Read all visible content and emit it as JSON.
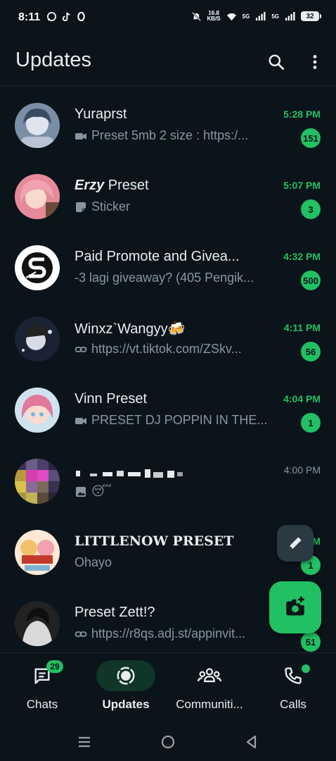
{
  "status_bar": {
    "time": "8:11",
    "speed_value": "16.8",
    "speed_unit": "KB/S",
    "net1": "5G",
    "net2": "5G",
    "battery": "32",
    "left_icons": [
      "whatsapp-icon",
      "tiktok-icon",
      "circle-o-icon"
    ],
    "right_icons": [
      "mute-icon",
      "wifi-icon",
      "signal-icon",
      "signal-icon",
      "battery-icon"
    ]
  },
  "header": {
    "title": "Updates",
    "icons": [
      "search-icon",
      "more-vert-icon"
    ]
  },
  "chats": [
    {
      "name": "Yuraprst",
      "time": "5:28 PM",
      "preview": "Preset 5mb 2 size : https:/...",
      "preview_icon": "video-icon",
      "unread": "151",
      "avatar_color": "#7a8ea6"
    },
    {
      "name_emph": "Erzy",
      "name": " Preset",
      "time": "5:07 PM",
      "preview": "Sticker",
      "preview_icon": "sticker-icon",
      "unread": "3",
      "avatar_color": "#e58a9b"
    },
    {
      "name": "Paid Promote and Givea...",
      "time": "4:32 PM",
      "preview": "-3 lagi giveaway? (405 Pengik...",
      "preview_icon": "",
      "unread": "500",
      "avatar_color": "#ffffff"
    },
    {
      "name": "Winxz`Wangyy🍻",
      "time": "4:11 PM",
      "preview": "https://vt.tiktok.com/ZSkv...",
      "preview_icon": "link-icon",
      "unread": "56",
      "avatar_color": "#1a2233"
    },
    {
      "name": "Vinn Preset",
      "time": "4:04 PM",
      "preview": "PRESET DJ POPPIN IN THE...",
      "preview_icon": "video-icon",
      "unread": "1",
      "avatar_color": "#e07a9b"
    },
    {
      "name": "",
      "time": "4:00 PM",
      "preview": "😴",
      "preview_icon": "image-icon",
      "unread": "",
      "avatar_color": "#5a4a7a"
    },
    {
      "name": "LITTLENOW PRESET",
      "time": "M",
      "preview": "Ohayo",
      "preview_icon": "",
      "unread": "1",
      "avatar_color": "#f2c26b"
    },
    {
      "name": "Preset Zett!?",
      "time": "",
      "preview": "https://r8qs.adj.st/appinvit...",
      "preview_icon": "link-icon",
      "unread": "51",
      "avatar_color": "#222222"
    }
  ],
  "fabs": {
    "small_icon": "pencil-icon",
    "big_icon": "camera-add-icon"
  },
  "bottom_nav": {
    "items": [
      {
        "label": "Chats",
        "icon": "chats-icon",
        "badge": "29"
      },
      {
        "label": "Updates",
        "icon": "status-icon"
      },
      {
        "label": "Communiti...",
        "icon": "communities-icon"
      },
      {
        "label": "Calls",
        "icon": "phone-icon"
      }
    ]
  },
  "colors": {
    "background": "#0b141a",
    "accent": "#21c063",
    "secondary_text": "#8696a0",
    "active_nav_pill": "#103529"
  }
}
